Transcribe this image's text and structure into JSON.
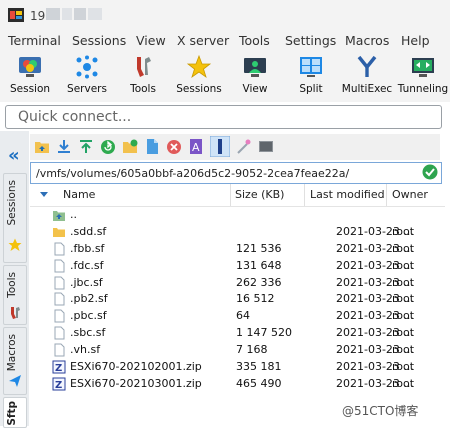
{
  "window": {
    "title": "19."
  },
  "menu": [
    "Terminal",
    "Sessions",
    "View",
    "X server",
    "Tools",
    "Settings",
    "Macros",
    "Help"
  ],
  "toolbar": [
    {
      "label": "Session",
      "icon": "session-icon"
    },
    {
      "label": "Servers",
      "icon": "servers-icon"
    },
    {
      "label": "Tools",
      "icon": "tools-icon"
    },
    {
      "label": "Sessions",
      "icon": "star-icon"
    },
    {
      "label": "View",
      "icon": "view-icon"
    },
    {
      "label": "Split",
      "icon": "split-icon"
    },
    {
      "label": "MultiExec",
      "icon": "multiexec-icon"
    },
    {
      "label": "Tunneling",
      "icon": "tunneling-icon"
    }
  ],
  "quick_connect": {
    "placeholder": "Quick connect..."
  },
  "left_tabs": [
    "Sessions",
    "Tools",
    "Macros",
    "Sftp"
  ],
  "path": "/vmfs/volumes/605a0bbf-a206d5c2-9052-2cea7feae22a/",
  "columns": {
    "name": "Name",
    "size": "Size (KB)",
    "modified": "Last modified",
    "owner": "Owner"
  },
  "files": [
    {
      "name": "..",
      "size": "",
      "modified": "",
      "owner": "",
      "kind": "up"
    },
    {
      "name": ".sdd.sf",
      "size": "",
      "modified": "2021-03-23 ...",
      "owner": "root",
      "kind": "folder"
    },
    {
      "name": ".fbb.sf",
      "size": "121 536",
      "modified": "2021-03-23 ...",
      "owner": "root",
      "kind": "file"
    },
    {
      "name": ".fdc.sf",
      "size": "131 648",
      "modified": "2021-03-23 ...",
      "owner": "root",
      "kind": "file"
    },
    {
      "name": ".jbc.sf",
      "size": "262 336",
      "modified": "2021-03-23 ...",
      "owner": "root",
      "kind": "file"
    },
    {
      "name": ".pb2.sf",
      "size": "16 512",
      "modified": "2021-03-23 ...",
      "owner": "root",
      "kind": "file"
    },
    {
      "name": ".pbc.sf",
      "size": "64",
      "modified": "2021-03-23 ...",
      "owner": "root",
      "kind": "file"
    },
    {
      "name": ".sbc.sf",
      "size": "1 147 520",
      "modified": "2021-03-23 ...",
      "owner": "root",
      "kind": "file"
    },
    {
      "name": ".vh.sf",
      "size": "7 168",
      "modified": "2021-03-23 ...",
      "owner": "root",
      "kind": "file"
    },
    {
      "name": "ESXi670-202102001.zip",
      "size": "335 181",
      "modified": "2021-03-23 ...",
      "owner": "root",
      "kind": "zip"
    },
    {
      "name": "ESXi670-202103001.zip",
      "size": "465 490",
      "modified": "2021-03-23 ...",
      "owner": "root",
      "kind": "zip"
    }
  ],
  "watermark": "@51CTO博客"
}
